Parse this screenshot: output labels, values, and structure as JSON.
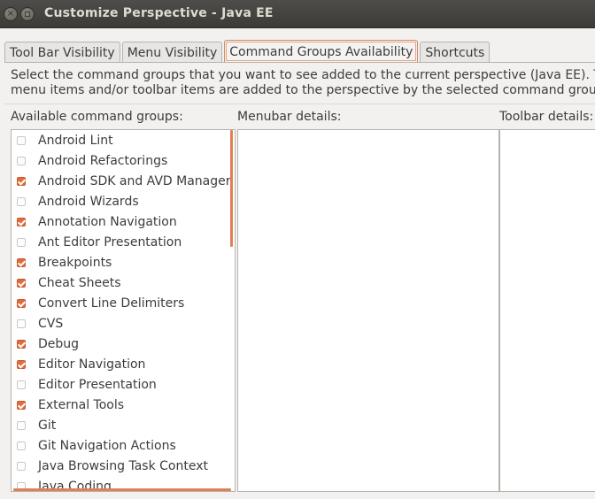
{
  "window": {
    "title": "Customize Perspective - Java EE",
    "close_glyph": "×"
  },
  "tabs": [
    {
      "label": "Tool Bar Visibility",
      "active": false
    },
    {
      "label": "Menu Visibility",
      "active": false
    },
    {
      "label": "Command Groups Availability",
      "active": true
    },
    {
      "label": "Shortcuts",
      "active": false
    }
  ],
  "description": {
    "line1": "Select the command groups that you want to see added to the current perspective (Java EE).  The de",
    "line2": "menu items and/or toolbar items are added to the perspective by the selected command group."
  },
  "columns": {
    "available_label": "Available command groups:",
    "menubar_label": "Menubar details:",
    "toolbar_label": "Toolbar details:"
  },
  "command_groups": [
    {
      "label": "Android Lint",
      "checked": false
    },
    {
      "label": "Android Refactorings",
      "checked": false
    },
    {
      "label": "Android SDK and AVD Manager",
      "checked": true
    },
    {
      "label": "Android Wizards",
      "checked": false
    },
    {
      "label": "Annotation Navigation",
      "checked": true
    },
    {
      "label": "Ant Editor Presentation",
      "checked": false
    },
    {
      "label": "Breakpoints",
      "checked": true
    },
    {
      "label": "Cheat Sheets",
      "checked": true
    },
    {
      "label": "Convert Line Delimiters",
      "checked": true
    },
    {
      "label": "CVS",
      "checked": false
    },
    {
      "label": "Debug",
      "checked": true
    },
    {
      "label": "Editor Navigation",
      "checked": true
    },
    {
      "label": "Editor Presentation",
      "checked": false
    },
    {
      "label": "External Tools",
      "checked": true
    },
    {
      "label": "Git",
      "checked": false
    },
    {
      "label": "Git Navigation Actions",
      "checked": false
    },
    {
      "label": "Java Browsing Task Context",
      "checked": false
    },
    {
      "label": "Java Coding",
      "checked": false
    }
  ],
  "colors": {
    "accent": "#e06c3c",
    "titlebar": "#3c3b37"
  }
}
